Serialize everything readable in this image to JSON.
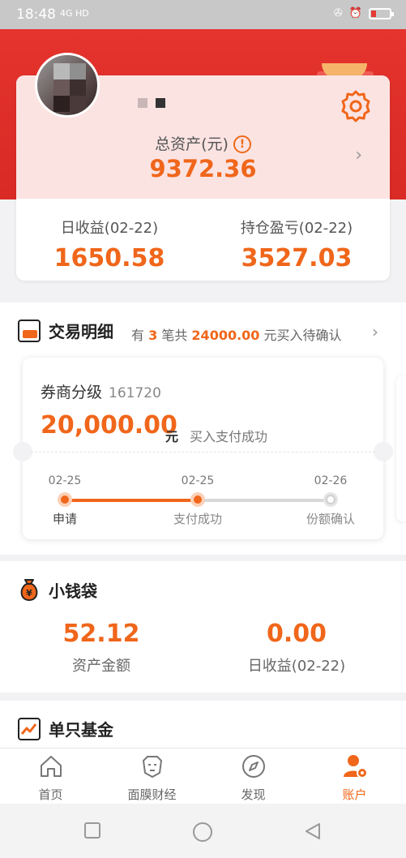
{
  "status_bar": {
    "time": "18:48",
    "signal": "4G HD"
  },
  "profile": {
    "settings_icon": "gear-icon"
  },
  "assets": {
    "total_label": "总资产(元)",
    "warn_symbol": "!",
    "total_value": "9372.36",
    "daily_label": "日收益(02-22)",
    "daily_value": "1650.58",
    "holding_label": "持仓盈亏(02-22)",
    "holding_value": "3527.03"
  },
  "trade": {
    "title": "交易明细",
    "summary_pre": "有 ",
    "summary_count": "3",
    "summary_mid": " 笔共 ",
    "summary_amount": "24000.00",
    "summary_post": " 元买入待确认",
    "card": {
      "fund_name": "券商分级",
      "fund_code": "161720",
      "amount": "20,000.00",
      "unit": "元",
      "status": "买入支付成功",
      "progress": 0.5,
      "steps": [
        {
          "date": "02-25",
          "name": "申请"
        },
        {
          "date": "02-25",
          "name": "支付成功"
        },
        {
          "date": "02-26",
          "name": "份额确认"
        }
      ]
    }
  },
  "wallet": {
    "title": "小钱袋",
    "asset_value": "52.12",
    "asset_label": "资产金额",
    "daily_value": "0.00",
    "daily_label": "日收益(02-22)"
  },
  "single_fund": {
    "title": "单只基金"
  },
  "tabs": [
    {
      "label": "首页",
      "icon": "home-icon"
    },
    {
      "label": "面膜财经",
      "icon": "lion-icon"
    },
    {
      "label": "发现",
      "icon": "compass-icon"
    },
    {
      "label": "账户",
      "icon": "account-icon"
    }
  ],
  "colors": {
    "accent": "#f0661a",
    "header_red": "#e5332d"
  }
}
